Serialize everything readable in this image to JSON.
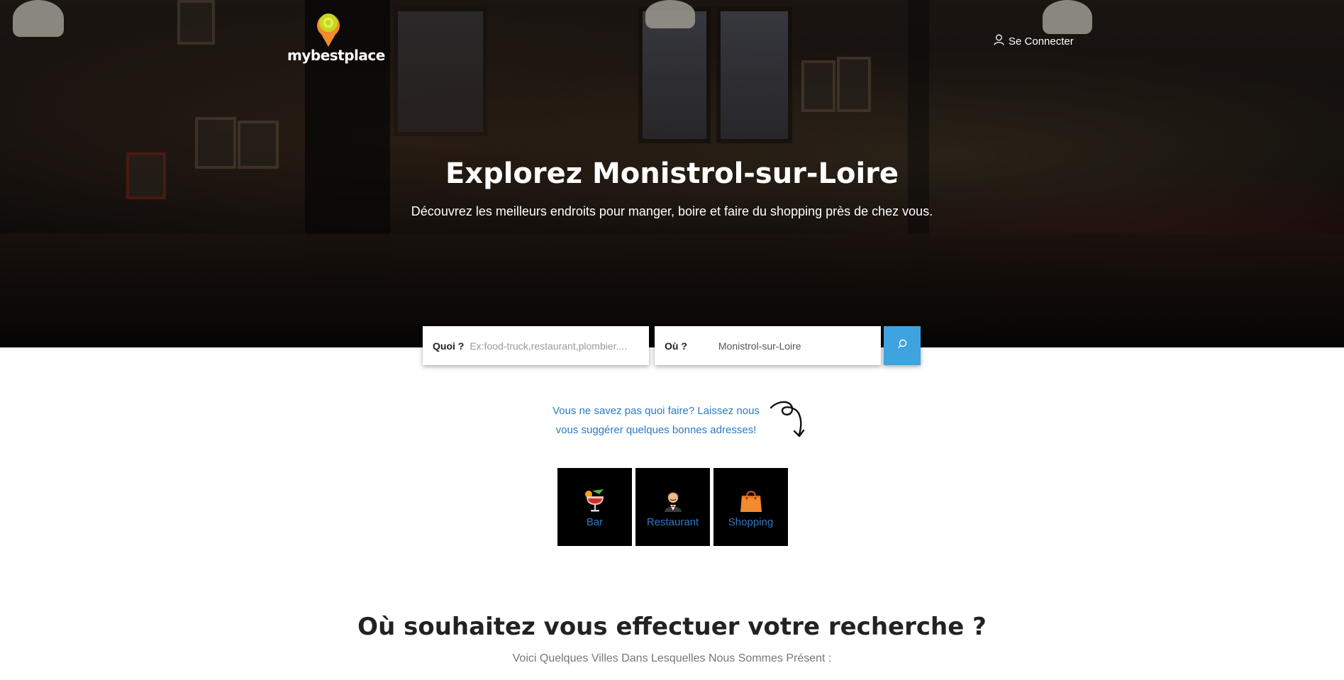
{
  "header": {
    "brand": "mybestplace",
    "login_label": "Se Connecter"
  },
  "hero": {
    "title": "Explorez Monistrol-sur-Loire",
    "subtitle": "Découvrez les meilleurs endroits pour manger, boire et faire du shopping près de chez vous."
  },
  "search": {
    "what_label": "Quoi ?",
    "what_placeholder": "Ex:food-truck,restaurant,plombier....",
    "where_label": "Où ?",
    "where_value": "Monistrol-sur-Loire",
    "button_icon": "search-icon"
  },
  "suggestion": {
    "line1": "Vous ne savez pas quoi faire? Laissez nous",
    "line2": "vous suggérer quelques bonnes adresses!"
  },
  "categories": [
    {
      "label": "Bar",
      "icon": "cocktail-icon"
    },
    {
      "label": "Restaurant",
      "icon": "waiter-icon"
    },
    {
      "label": "Shopping",
      "icon": "shopping-bag-icon"
    }
  ],
  "cities_section": {
    "title": "Où souhaitez vous effectuer votre recherche ?",
    "subtitle": "Voici Quelques Villes Dans Lesquelles Nous Sommes Présent :"
  },
  "colors": {
    "accent_blue": "#3fa3e0",
    "link_blue": "#2d79c4",
    "logo_orange": "#f28a2e",
    "logo_lime": "#c8d61e"
  }
}
